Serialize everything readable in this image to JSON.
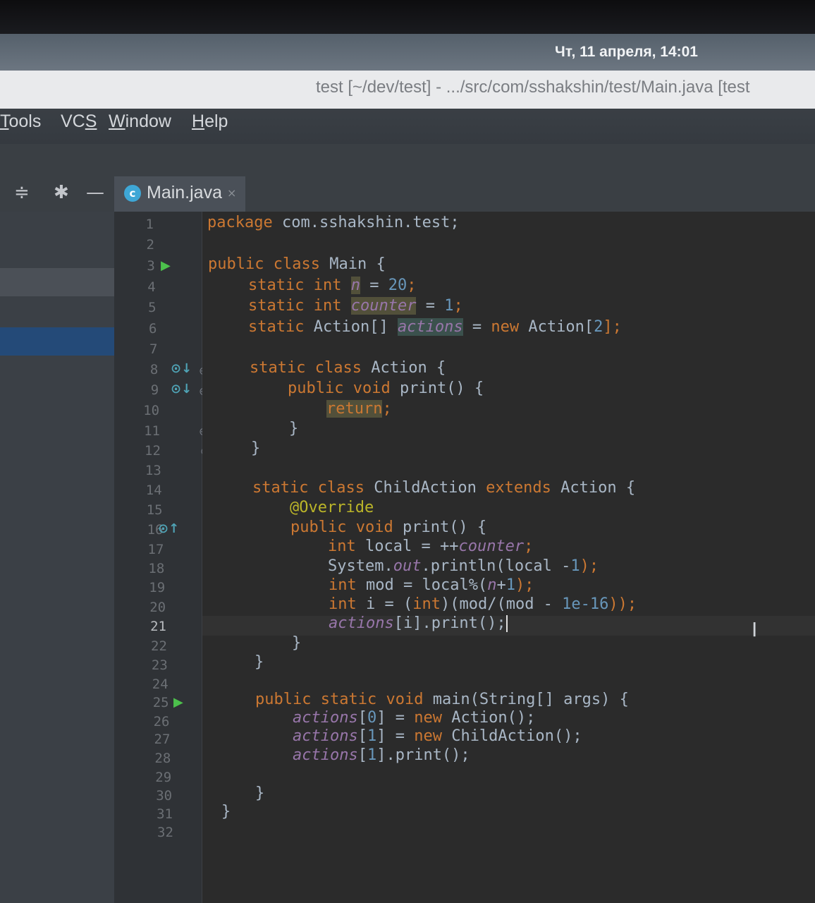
{
  "system": {
    "clock": "Чт, 11 апреля, 14:01"
  },
  "window": {
    "title": "test [~/dev/test] - .../src/com/sshakshin/test/Main.java [test"
  },
  "menu": [
    {
      "label": "Tools",
      "underline": "T",
      "rest": "ools"
    },
    {
      "label": "VCS",
      "underline_pre": "VC",
      "underline": "S"
    },
    {
      "label": "Window",
      "underline_pre": "",
      "underline": "W",
      "rest": "indow"
    },
    {
      "label": "Help",
      "underline": "H",
      "rest": "elp"
    }
  ],
  "toolbar": {
    "collapse_icon": "collapse-icon",
    "settings_icon": "gear-icon",
    "hide_icon": "minimize-icon"
  },
  "tab": {
    "label": "Main.java",
    "icon": "java-class-icon",
    "close": "×"
  },
  "current_line": 21,
  "line_numbers": [
    "1",
    "2",
    "3",
    "4",
    "5",
    "6",
    "7",
    "8",
    "9",
    "10",
    "11",
    "12",
    "13",
    "14",
    "15",
    "16",
    "17",
    "18",
    "19",
    "20",
    "21",
    "22",
    "23",
    "24",
    "25",
    "26",
    "27",
    "28",
    "29",
    "30",
    "31",
    "32"
  ],
  "code": {
    "l1": {
      "kw": "package",
      "rest": " com.sshakshin.test;"
    },
    "l3": {
      "kw1": "public",
      "kw2": "class",
      "rest": " Main {"
    },
    "l4": {
      "kw1": "static",
      "kw2": "int",
      "var": "n",
      "eq": " = ",
      "num": "20",
      "end": ";"
    },
    "l5": {
      "kw1": "static",
      "kw2": "int",
      "var": "counter",
      "eq": " = ",
      "num": "1",
      "end": ";"
    },
    "l6": {
      "kw1": "static",
      "type": " Action[] ",
      "var": "actions",
      "eq": " = ",
      "kw3": "new",
      "rest": " Action[",
      "num": "2",
      "end": "];"
    },
    "l8": {
      "kw1": "static",
      "kw2": "class",
      "rest": " Action {"
    },
    "l9": {
      "kw1": "public",
      "kw2": "void",
      "rest": " print() {"
    },
    "l10": {
      "kw": "return",
      "end": ";"
    },
    "l11": "}",
    "l12": "}",
    "l14": {
      "kw1": "static",
      "kw2": "class",
      "mid": " ChildAction ",
      "kw3": "extends",
      "rest": " Action {"
    },
    "l15": "@Override",
    "l16": {
      "kw1": "public",
      "kw2": "void",
      "rest": " print() {"
    },
    "l17": {
      "kw": "int",
      "mid": " local = ++",
      "fld": "counter",
      "end": ";"
    },
    "l18": {
      "pre": "System.",
      "fld": "out",
      "mid": ".println(local -",
      "num": "1",
      "end": ");"
    },
    "l19": {
      "kw": "int",
      "mid": " mod = local%(",
      "fld": "n",
      "mid2": "+",
      "num": "1",
      "end": ");"
    },
    "l20": {
      "kw": "int",
      "mid": " i = (",
      "kw2": "int",
      "mid2": ")(mod/(mod - ",
      "num": "1e-16",
      "end": "));"
    },
    "l21": {
      "fld": "actions",
      "rest": "[i].print();"
    },
    "l22": "}",
    "l23": "}",
    "l25": {
      "kw1": "public",
      "kw2": "static",
      "kw3": "void",
      "rest": " main(String[] args) {"
    },
    "l26": {
      "fld": "actions",
      "pre": "[",
      "num": "0",
      "mid": "] = ",
      "kw": "new",
      "rest": " Action();"
    },
    "l27": {
      "fld": "actions",
      "pre": "[",
      "num": "1",
      "mid": "] = ",
      "kw": "new",
      "rest": " ChildAction();"
    },
    "l28": {
      "fld": "actions",
      "pre": "[",
      "num": "1",
      "rest": "].print();"
    },
    "l30": "}",
    "l31": "}"
  },
  "colors": {
    "keyword": "#cc7832",
    "number": "#6897bb",
    "annotation": "#bbb529",
    "field": "#9876aa",
    "text": "#a9b7c6",
    "editor_bg": "#2b2b2b"
  }
}
